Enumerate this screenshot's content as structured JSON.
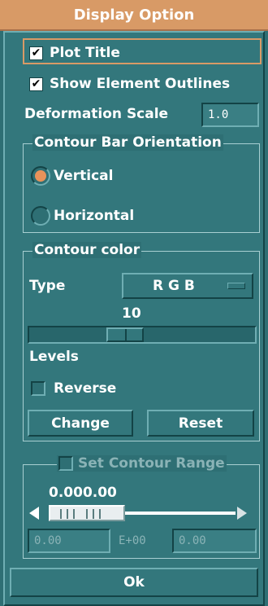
{
  "window": {
    "title": "Display Option"
  },
  "plot_title": {
    "label": "Plot Title",
    "checked": true
  },
  "show_outlines": {
    "label": "Show Element Outlines",
    "checked": true
  },
  "deformation": {
    "label": "Deformation Scale",
    "value": "1.0"
  },
  "orientation": {
    "title": "Contour Bar Orientation",
    "options": [
      {
        "label": "Vertical",
        "selected": true
      },
      {
        "label": "Horizontal",
        "selected": false
      }
    ]
  },
  "contour_color": {
    "title": "Contour color",
    "type_label": "Type",
    "type_value": "R G B",
    "levels_value": "10",
    "levels_fraction": 0.41,
    "levels_label": "Levels",
    "reverse_label": "Reverse",
    "reverse_checked": false,
    "change_label": "Change",
    "reset_label": "Reset"
  },
  "contour_range": {
    "title": "Set Contour Range",
    "enabled": false,
    "value_display": "0.000.00",
    "min_value": "0.00",
    "exp_label": "E+00",
    "max_value": "0.00"
  },
  "ok_label": "Ok",
  "colors": {
    "accent": "#d89a66",
    "panel": "#2e6f74",
    "radio": "#e8925a"
  }
}
